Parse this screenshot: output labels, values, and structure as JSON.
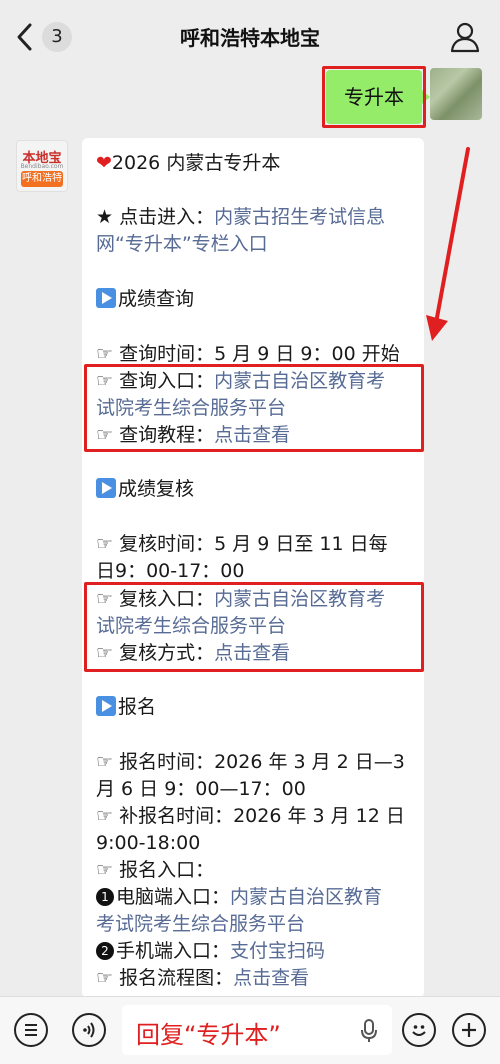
{
  "header": {
    "back_count": "3",
    "title": "呼和浩特本地宝"
  },
  "outgoing": {
    "text": "专升本"
  },
  "bot_avatar": {
    "logo": "本地宝",
    "domain": "Bendibao.com",
    "city": "呼和浩特"
  },
  "message": {
    "title": "2026 内蒙古专升本",
    "entry_prefix": "★ 点击进入：",
    "entry_link_1": "内蒙古招生考试信息",
    "entry_link_2": "网“专升本”专栏入口",
    "sec_score": "成绩查询",
    "score_time": "查询时间：5 月 9 日 9：00 开始",
    "score_entry_label": "查询入口：",
    "score_entry_link_1": "内蒙古自治区教育考",
    "score_entry_link_2": "试院考生综合服务平台",
    "score_tutorial_label": "查询教程：",
    "score_tutorial_link": "点击查看",
    "sec_recheck": "成绩复核",
    "recheck_time_1": "复核时间：5 月 9 日至 11 日每",
    "recheck_time_2": "日9：00-17：00",
    "recheck_entry_label": "复核入口：",
    "recheck_entry_link_1": "内蒙古自治区教育考",
    "recheck_entry_link_2": "试院考生综合服务平台",
    "recheck_method_label": "复核方式：",
    "recheck_method_link": "点击查看",
    "sec_signup": "报名",
    "signup_time_1": "报名时间：2026 年 3 月 2 日—3",
    "signup_time_2": "月 6 日 9：00—17：00",
    "late_signup_1": "补报名时间：2026 年 3 月 12 日",
    "late_signup_2": "9:00-18:00",
    "signup_entry": "报名入口：",
    "pc_entry_label": "电脑端入口：",
    "pc_entry_link_1": "内蒙古自治区教育",
    "pc_entry_link_2": "考试院考生综合服务平台",
    "mobile_entry_label": "手机端入口：",
    "mobile_entry_link": "支付宝扫码",
    "process_label": "报名流程图：",
    "process_link": "点击查看"
  },
  "input": {
    "value": "回复“专升本”"
  },
  "colors": {
    "bubble_green": "#95ec69",
    "link": "#576b95",
    "highlight_red": "#e02020"
  }
}
